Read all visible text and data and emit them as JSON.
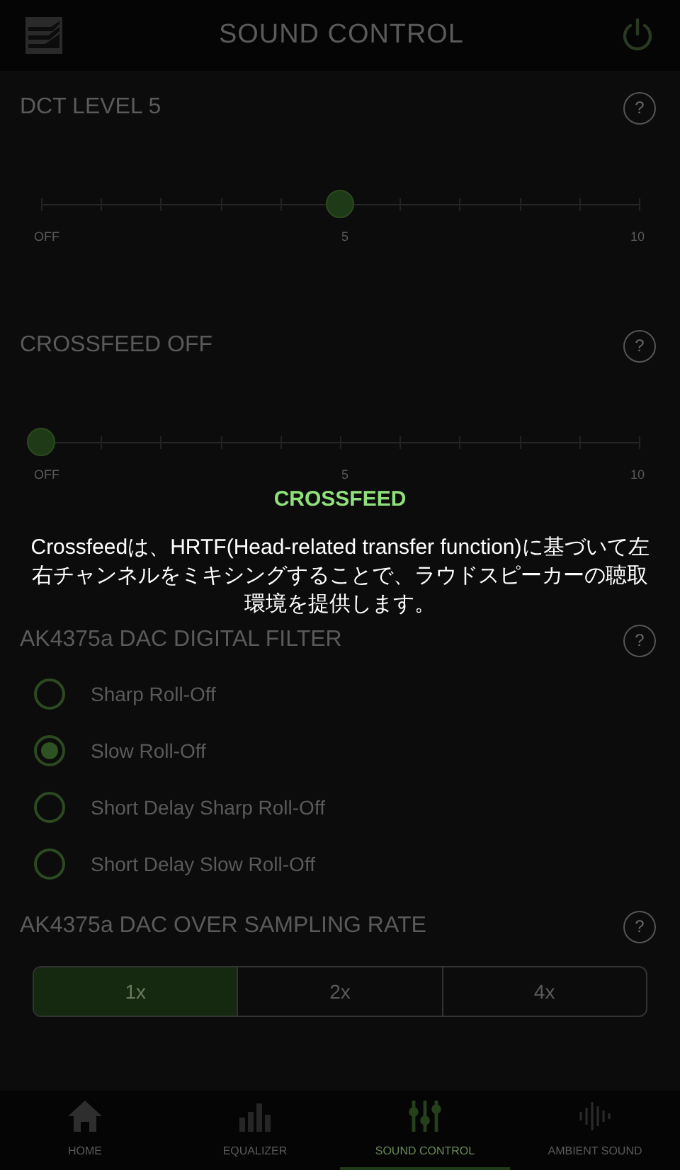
{
  "header": {
    "title": "SOUND CONTROL"
  },
  "sliders": [
    {
      "label": "DCT LEVEL  5",
      "help": "?",
      "level": 0.5,
      "ticks": [
        "OFF",
        "5",
        "10"
      ]
    },
    {
      "label": "CROSSFEED OFF",
      "help": "?",
      "level": 0,
      "ticks": [
        "OFF",
        "5",
        "10"
      ]
    }
  ],
  "filter": {
    "label": "AK4375a DAC DIGITAL FILTER",
    "help": "?",
    "options": [
      {
        "label": "Sharp Roll-Off",
        "selected": false
      },
      {
        "label": "Slow Roll-Off",
        "selected": true
      },
      {
        "label": "Short Delay Sharp Roll-Off",
        "selected": false
      },
      {
        "label": "Short Delay Slow Roll-Off",
        "selected": false
      }
    ]
  },
  "oversampling": {
    "label": "AK4375a DAC OVER SAMPLING RATE",
    "help": "?",
    "options": [
      {
        "label": "1x",
        "selected": true
      },
      {
        "label": "2x",
        "selected": false
      },
      {
        "label": "4x",
        "selected": false
      }
    ]
  },
  "nav": [
    {
      "label": "HOME",
      "kind": "home",
      "selected": false
    },
    {
      "label": "EQUALIZER",
      "kind": "equalizer",
      "selected": false
    },
    {
      "label": "SOUND CONTROL",
      "kind": "mixer",
      "selected": true
    },
    {
      "label": "AMBIENT SOUND",
      "kind": "wave",
      "selected": false
    }
  ],
  "popup": {
    "title": "CROSSFEED",
    "text": "Crossfeedは、HRTF(Head-related transfer function)に基づいて左右チャンネルをミキシングすることで、ラウドスピーカーの聴取環境を提供します。"
  }
}
